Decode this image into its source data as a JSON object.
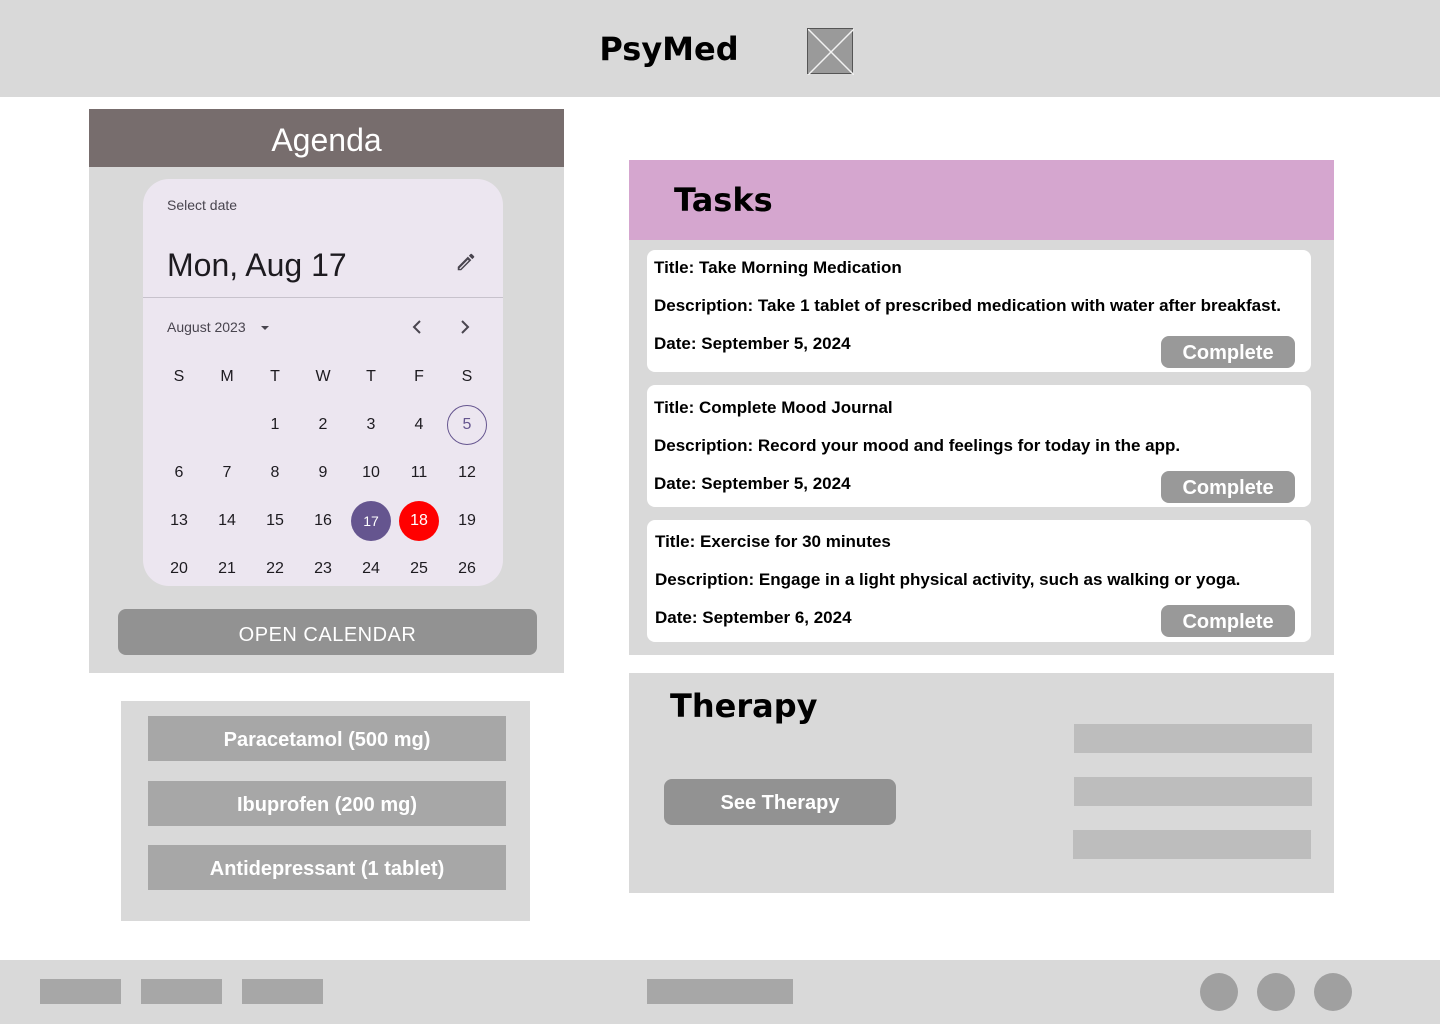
{
  "header": {
    "title": "PsyMed",
    "logo_icon": "image-placeholder-icon"
  },
  "agenda": {
    "title": "Agenda",
    "datepicker": {
      "supporting_text": "Select date",
      "headline": "Mon, Aug 17",
      "month_year": "August 2023",
      "weekdays": [
        "S",
        "M",
        "T",
        "W",
        "T",
        "F",
        "S"
      ],
      "weeks": [
        [
          "",
          "",
          "1",
          "2",
          "3",
          "4",
          "5"
        ],
        [
          "6",
          "7",
          "8",
          "9",
          "10",
          "11",
          "12"
        ],
        [
          "13",
          "14",
          "15",
          "16",
          "17",
          "18",
          "19"
        ],
        [
          "20",
          "21",
          "22",
          "23",
          "24",
          "25",
          "26"
        ]
      ],
      "today": "5",
      "selected": "17",
      "highlighted": "18",
      "colors": {
        "selected": "#65558f",
        "highlighted": "#ff0000"
      }
    },
    "open_calendar_label": "OPEN CALENDAR"
  },
  "medications": [
    {
      "label": "Paracetamol (500 mg)"
    },
    {
      "label": "Ibuprofen (200 mg)"
    },
    {
      "label": "Antidepressant (1 tablet)"
    }
  ],
  "tasks": {
    "title": "Tasks",
    "items": [
      {
        "title": "Title: Take Morning Medication",
        "description": "Description: Take 1 tablet of prescribed medication with water after breakfast.",
        "date": "Date: September 5, 2024",
        "button": "Complete"
      },
      {
        "title": "Title: Complete Mood Journal",
        "description": "Description: Record your mood and feelings for today in the app.",
        "date": "Date: September 5, 2024",
        "button": "Complete"
      },
      {
        "title": "Title: Exercise for 30 minutes",
        "description": "Description: Engage in a light physical activity, such as walking or yoga.",
        "date": "Date: September 6, 2024",
        "button": "Complete"
      }
    ]
  },
  "therapy": {
    "title": "Therapy",
    "button": "See Therapy"
  },
  "colors": {
    "header_bg": "#d9d9d9",
    "agenda_header": "#776d6d",
    "tasks_header": "#d5a6cf"
  }
}
